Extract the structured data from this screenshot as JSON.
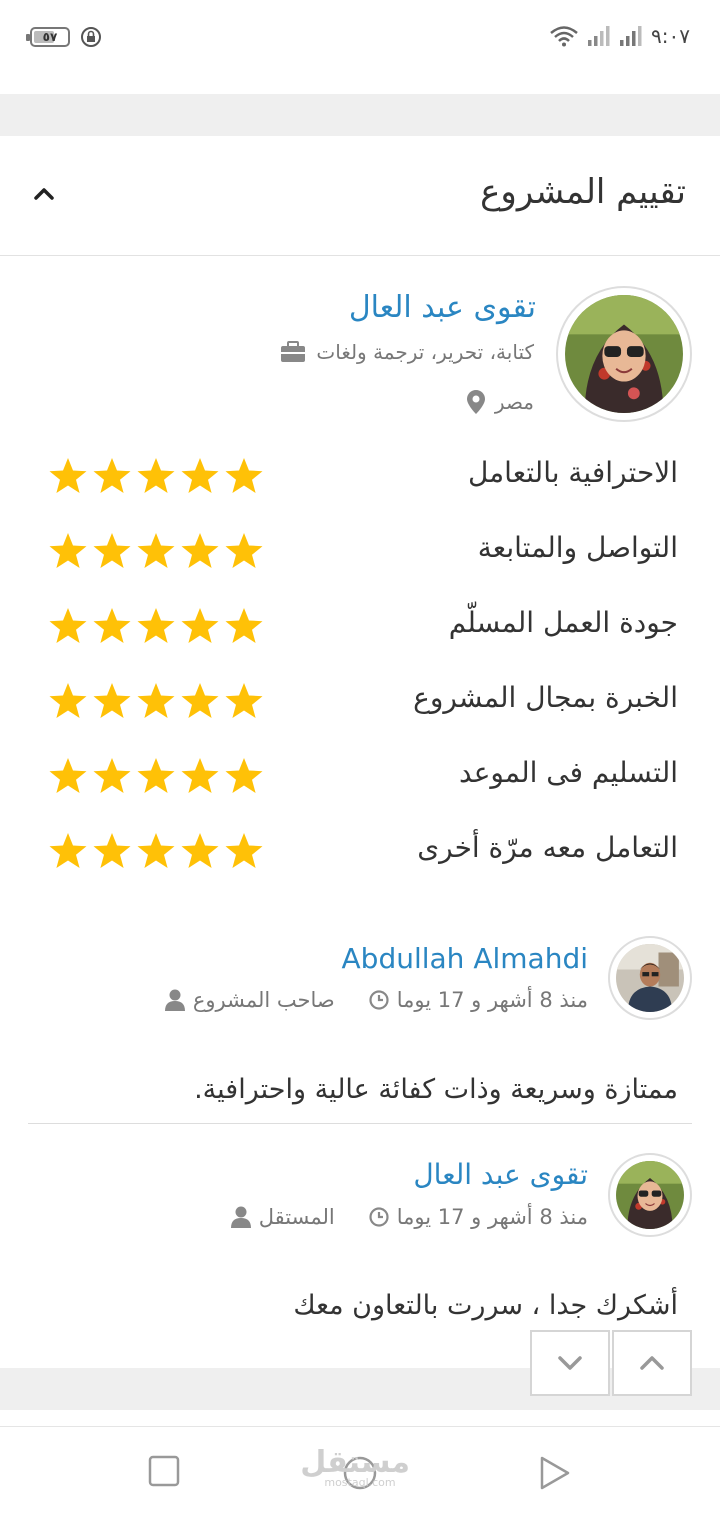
{
  "status_bar": {
    "battery": "٥٧",
    "time": "٩:٠٧"
  },
  "header": {
    "title": "تقييم المشروع"
  },
  "freelancer": {
    "name": "تقوى عبد العال",
    "specialty": "كتابة، تحرير، ترجمة ولغات",
    "country": "مصر"
  },
  "ratings": [
    {
      "label": "الاحترافية بالتعامل",
      "stars": 5
    },
    {
      "label": "التواصل والمتابعة",
      "stars": 5
    },
    {
      "label": "جودة العمل المسلّم",
      "stars": 5
    },
    {
      "label": "الخبرة بمجال المشروع",
      "stars": 5
    },
    {
      "label": "التسليم فى الموعد",
      "stars": 5
    },
    {
      "label": "التعامل معه مرّة أخرى",
      "stars": 5
    }
  ],
  "reviews": [
    {
      "name": "Abdullah Almahdi",
      "role": "صاحب المشروع",
      "time": "منذ 8 أشهر و 17 يوما",
      "text": "ممتازة وسريعة وذات كفائة عالية واحترافية."
    },
    {
      "name": "تقوى عبد العال",
      "role": "المستقل",
      "time": "منذ 8 أشهر و 17 يوما",
      "text": "أشكرك جدا ، سررت بالتعاون معك"
    }
  ],
  "watermark": {
    "brand": "مستقل",
    "domain": "mostaql.com"
  },
  "colors": {
    "link": "#2a86c2",
    "star": "#ffc107",
    "band": "#efefef"
  }
}
